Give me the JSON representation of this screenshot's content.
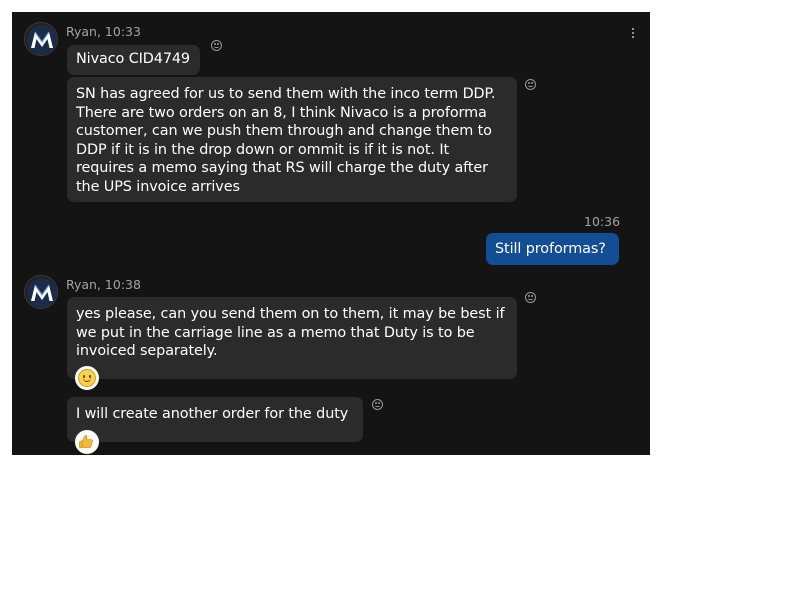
{
  "messages": [
    {
      "sender": "Ryan",
      "time": "10:33",
      "header": "Ryan, 10:33",
      "bubbles": [
        {
          "text": "Nivaco CID4749"
        },
        {
          "text": "SN has agreed for us to send them with the inco term DDP. There are two orders on an 8, I think Nivaco is a proforma customer, can we push them through and change them to DDP if it is in the drop down or ommit is if it is not. It requires a memo saying that RS will charge the duty after the UPS invoice arrives"
        }
      ]
    },
    {
      "sender": "me",
      "time": "10:36",
      "bubbles": [
        {
          "text": "Still proformas?"
        }
      ]
    },
    {
      "sender": "Ryan",
      "time": "10:38",
      "header": "Ryan, 10:38",
      "bubbles": [
        {
          "text": "yes please, can you send them on to them, it may be best if we put in the carriage line as a memo that Duty is to be invoiced separately.",
          "reaction": "smile-emoji"
        },
        {
          "text": "I will create another order for the duty",
          "reaction": "thumbs-up-emoji"
        }
      ]
    }
  ],
  "colors": {
    "background": "#141414",
    "incoming_bubble": "#2b2b2b",
    "outgoing_bubble": "#134d96",
    "meta_text": "#a3a3a3",
    "text": "#ffffff"
  },
  "icons": {
    "more_options": "more-options-icon",
    "add_reaction": "add-reaction-icon",
    "avatar_logo": "m-logo-avatar"
  }
}
